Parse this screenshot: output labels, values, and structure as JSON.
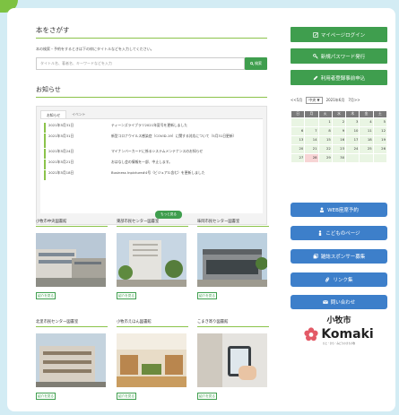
{
  "search": {
    "title": "本をさがす",
    "description": "本の検索・予約をするときは下の枠にタイトルなどを入力してください。",
    "placeholder": "タイトル名、著者名、キーワードなどを入力",
    "button": "検索"
  },
  "news": {
    "title": "お知らせ",
    "tabs": [
      "お知らせ",
      "イベント"
    ],
    "items": [
      {
        "date": "2021年5月31日",
        "text": "ティーンズライブラリ2021年夏号を更新しました"
      },
      {
        "date": "2021年5月31日",
        "text": "新型コロナウイルス感染症（COVID-19）に関する対応について（5月31日更新）"
      },
      {
        "date": "2021年5月24日",
        "text": "マイナンバーカードに係るシステムメンテナンスのお知らせ"
      },
      {
        "date": "2021年5月21日",
        "text": "おはなし会の情報を一部、中止します。"
      },
      {
        "date": "2021年5月18日",
        "text": "Business Inpicture#4号（ビジュアル含む）を更新しました"
      }
    ],
    "more": "もっと見る"
  },
  "libraries": [
    {
      "name": "小牧市中央図書館",
      "button": "紹介を見る"
    },
    {
      "name": "東部市民センター図書室",
      "button": "紹介を見る"
    },
    {
      "name": "味岡市民センター図書室",
      "button": "紹介を見る"
    },
    {
      "name": "北里市民センター図書室",
      "button": "紹介を見る"
    },
    {
      "name": "小牧市えほん図書館",
      "button": "紹介を見る"
    },
    {
      "name": "こまき寄り図書館",
      "button": "紹介を見る"
    }
  ],
  "sidebar": {
    "green_buttons": [
      "マイページログイン",
      "新規パスワード発行",
      "利用者登録事前申込"
    ],
    "calendar": {
      "prev": "<<5月",
      "select_value": "中央",
      "month_label": "2021年6月",
      "next": "7月>>",
      "weekdays": [
        "日",
        "月",
        "火",
        "水",
        "木",
        "金",
        "土"
      ],
      "weeks": [
        [
          "",
          "",
          "1",
          "2",
          "3",
          "4",
          "5"
        ],
        [
          "6",
          "7",
          "8",
          "9",
          "10",
          "11",
          "12"
        ],
        [
          "13",
          "14",
          "15",
          "16",
          "17",
          "18",
          "19"
        ],
        [
          "20",
          "21",
          "22",
          "23",
          "24",
          "25",
          "26"
        ],
        [
          "27",
          "28",
          "29",
          "30",
          "",
          "",
          ""
        ]
      ]
    },
    "blue_buttons": [
      "WEB座席予約",
      "こどものページ",
      "雑誌スポンサー募集",
      "リンク集",
      "問い合わせ"
    ],
    "logo": {
      "city": "小牧市",
      "word": "Komaki",
      "tagline": "ひと・まち・みどりのまち小牧"
    }
  },
  "colors": {
    "green": "#3f9e4e",
    "blue": "#3d7fca",
    "accent_line": "#8bc34a",
    "background": "#d3ecf4"
  }
}
